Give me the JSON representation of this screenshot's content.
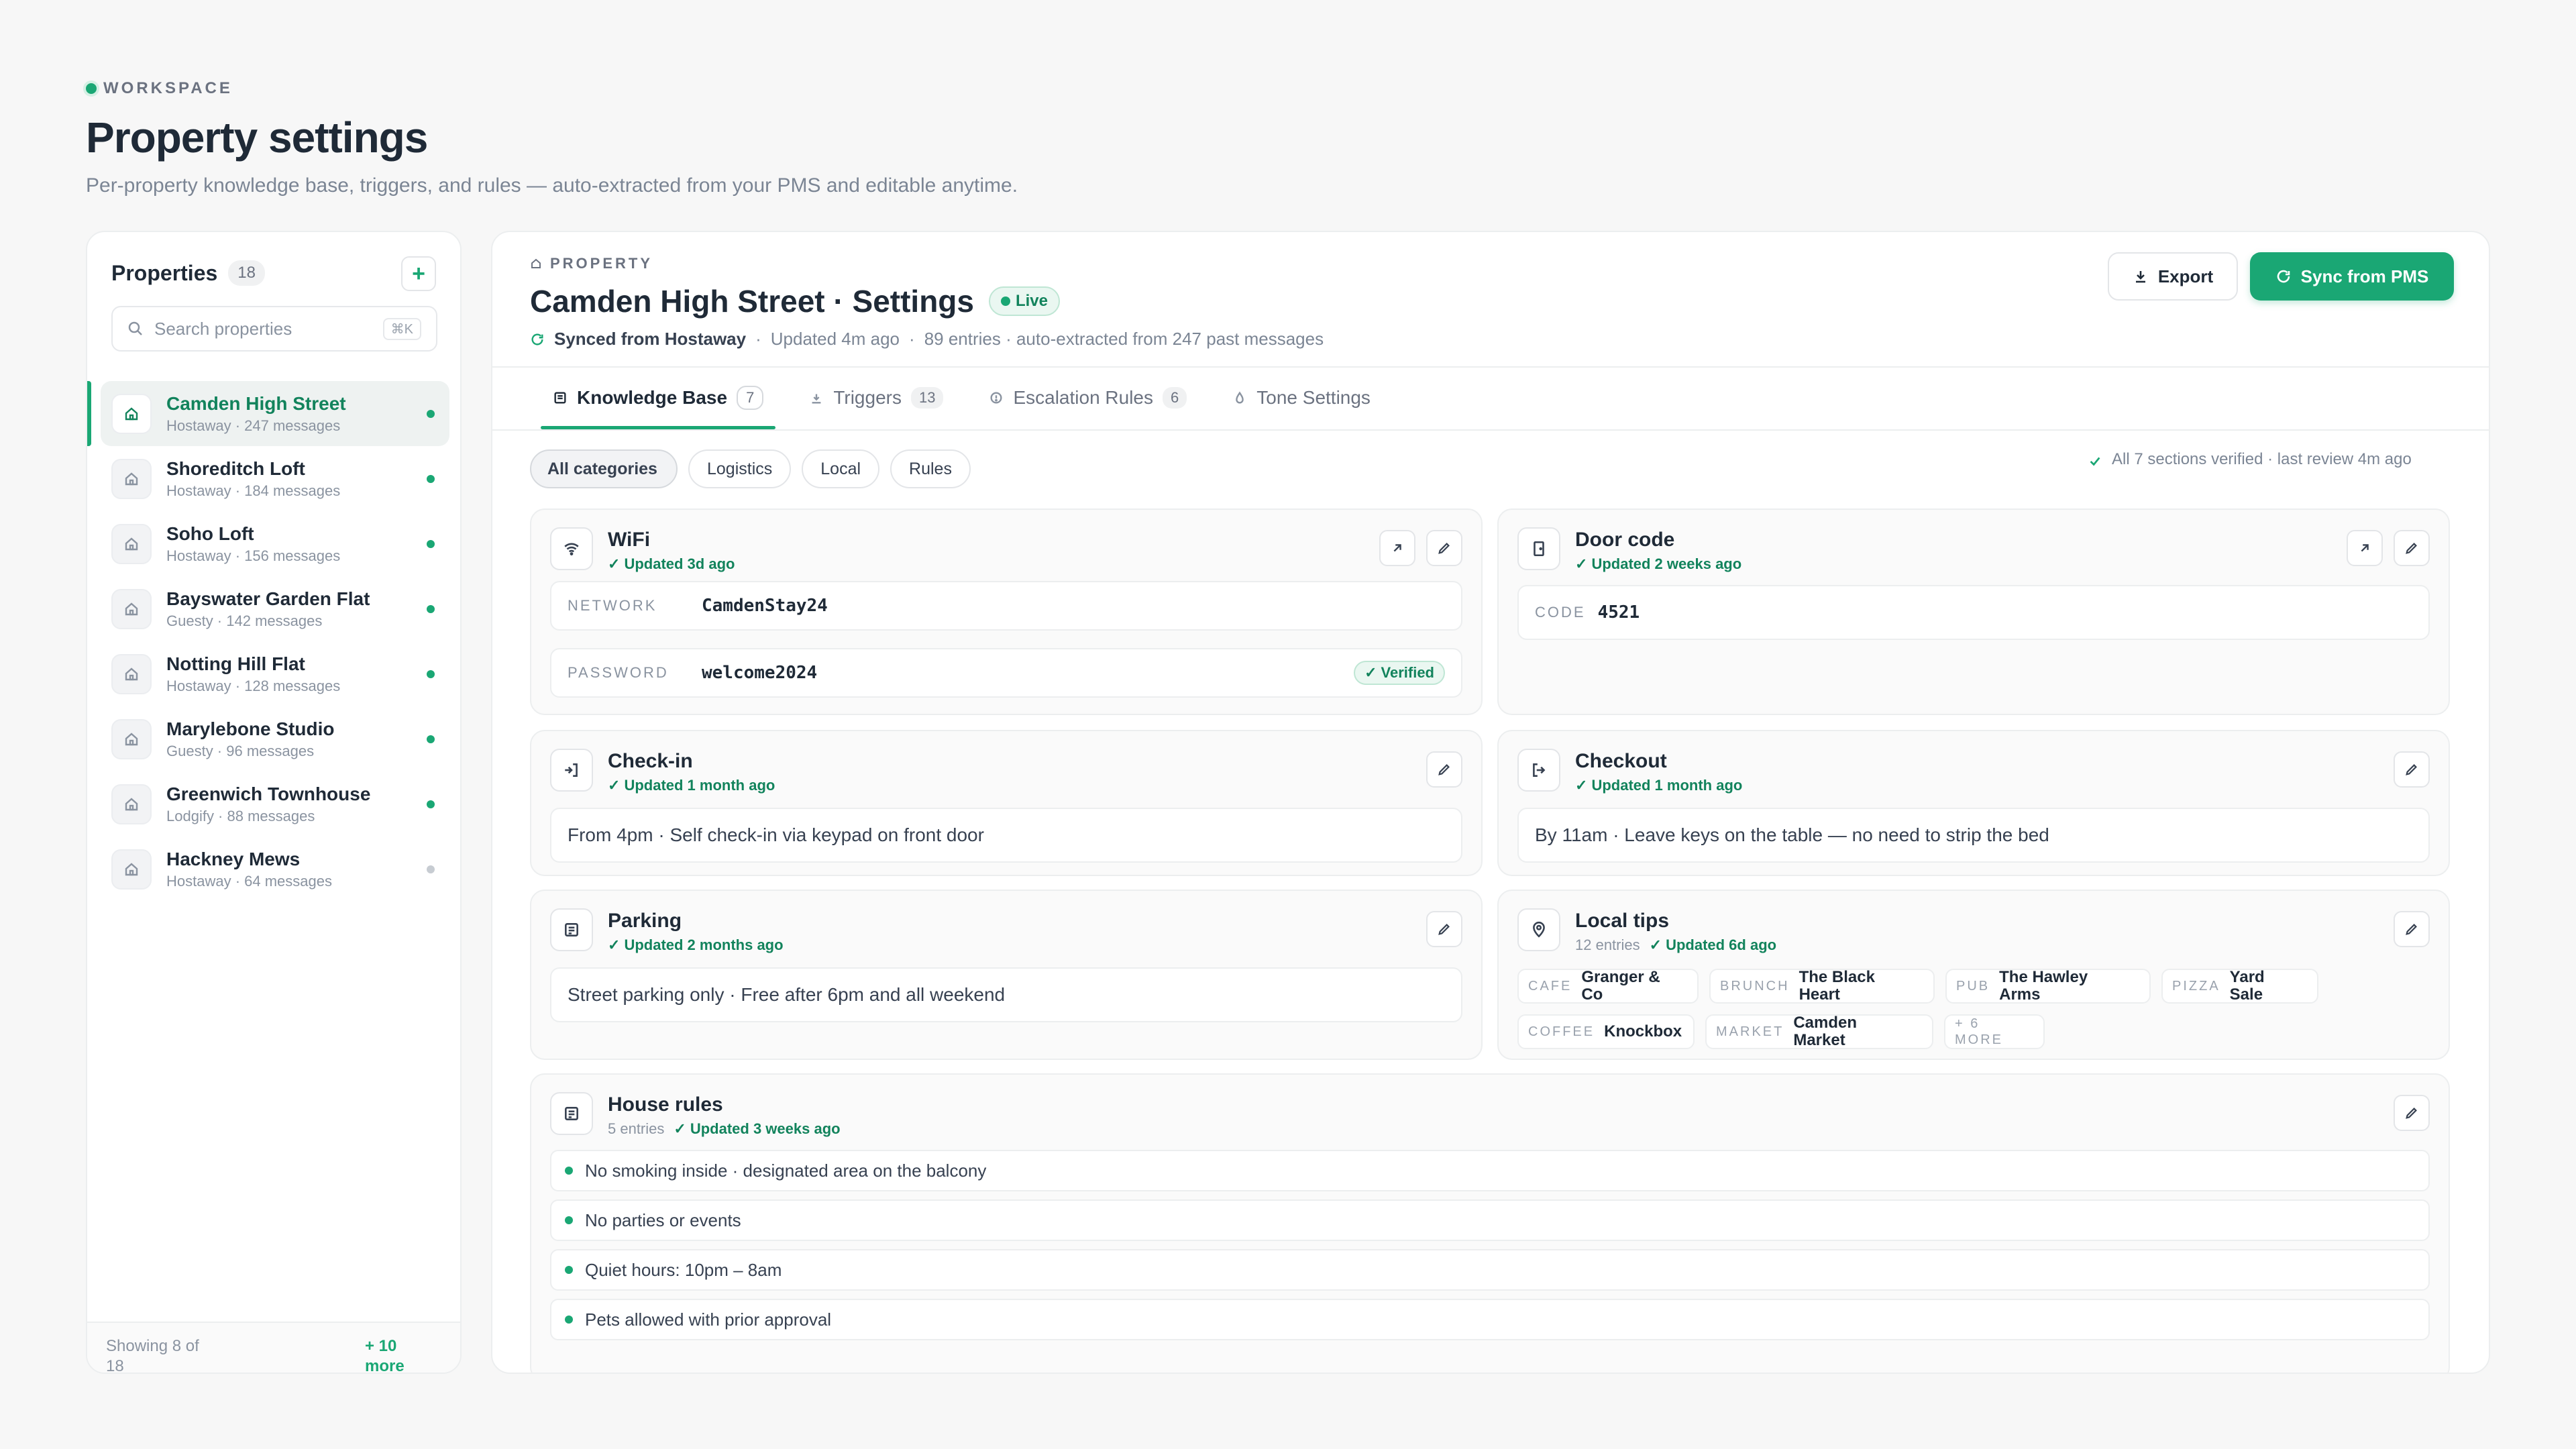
{
  "header": {
    "eyebrow": "WORKSPACE",
    "title": "Property settings",
    "subtitle": "Per-property knowledge base, triggers, and rules — auto-extracted from your PMS and editable anytime."
  },
  "sidebar": {
    "title": "Properties",
    "count": "18",
    "add_label": "+",
    "search_placeholder": "Search properties",
    "search_shortcut": "⌘K",
    "items": [
      {
        "name": "Camden High Street",
        "meta": "Hostaway · 247 messages",
        "active": true,
        "status": "online"
      },
      {
        "name": "Shoreditch Loft",
        "meta": "Hostaway · 184 messages",
        "status": "online"
      },
      {
        "name": "Soho Loft",
        "meta": "Hostaway · 156 messages",
        "status": "online"
      },
      {
        "name": "Bayswater Garden Flat",
        "meta": "Guesty · 142 messages",
        "status": "online"
      },
      {
        "name": "Notting Hill Flat",
        "meta": "Hostaway · 128 messages",
        "status": "online"
      },
      {
        "name": "Marylebone Studio",
        "meta": "Guesty · 96 messages",
        "status": "online"
      },
      {
        "name": "Greenwich Townhouse",
        "meta": "Lodgify · 88 messages",
        "status": "online"
      },
      {
        "name": "Hackney Mews",
        "meta": "Hostaway · 64 messages",
        "status": "idle"
      }
    ],
    "footer_showing": "Showing 8 of 18",
    "footer_more": "+ 10 more"
  },
  "main": {
    "eyebrow": "PROPERTY",
    "title": "Camden High Street · Settings",
    "live_label": "Live",
    "synced_label": "Synced from Hostaway",
    "updated": "Updated 4m ago",
    "entries_note": "89 entries · auto-extracted from 247 past messages",
    "export_label": "Export",
    "sync_label": "Sync from PMS",
    "tabs": [
      {
        "label": "Knowledge Base",
        "count": "7",
        "icon": "book-icon"
      },
      {
        "label": "Triggers",
        "count": "13",
        "icon": "download-icon"
      },
      {
        "label": "Escalation Rules",
        "count": "6",
        "icon": "alert-circle-icon"
      },
      {
        "label": "Tone Settings",
        "count": "",
        "icon": "droplet-icon"
      }
    ],
    "filters": [
      "All categories",
      "Logistics",
      "Local",
      "Rules"
    ],
    "verified_note": "All 7 sections verified · last review 4m ago",
    "wifi": {
      "title": "WiFi",
      "updated": "Updated 3d ago",
      "network_label": "NETWORK",
      "network": "CamdenStay24",
      "password_label": "PASSWORD",
      "password": "welcome2024",
      "verified_label": "Verified"
    },
    "door": {
      "title": "Door code",
      "updated": "Updated 2 weeks ago",
      "code_label": "CODE",
      "code": "4521"
    },
    "checkin": {
      "title": "Check-in",
      "updated": "Updated 1 month ago",
      "text": "From 4pm · Self check-in via keypad on front door"
    },
    "checkout": {
      "title": "Checkout",
      "updated": "Updated 1 month ago",
      "text": "By 11am · Leave keys on the table — no need to strip the bed"
    },
    "parking": {
      "title": "Parking",
      "updated": "Updated 2 months ago",
      "text": "Street parking only · Free after 6pm and all weekend"
    },
    "local": {
      "title": "Local tips",
      "entries": "12 entries",
      "updated": "Updated 6d ago",
      "tips_row1": [
        {
          "cat": "CAFE",
          "name": "Granger & Co"
        },
        {
          "cat": "BRUNCH",
          "name": "The Black Heart"
        },
        {
          "cat": "PUB",
          "name": "The Hawley Arms"
        },
        {
          "cat": "PIZZA",
          "name": "Yard Sale"
        }
      ],
      "tips_row2": [
        {
          "cat": "COFFEE",
          "name": "Knockbox"
        },
        {
          "cat": "MARKET",
          "name": "Camden Market"
        }
      ],
      "more": "+ 6 MORE"
    },
    "rules": {
      "title": "House rules",
      "entries": "5 entries",
      "updated": "Updated 3 weeks ago",
      "items": [
        "No smoking inside · designated area on the balcony",
        "No parties or events",
        "Quiet hours: 10pm – 8am",
        "Pets allowed with prior approval"
      ]
    }
  },
  "colors": {
    "accent": "#1aa774",
    "accent_dark": "#12835c",
    "text": "#1f2a37",
    "muted": "#7b8594"
  }
}
